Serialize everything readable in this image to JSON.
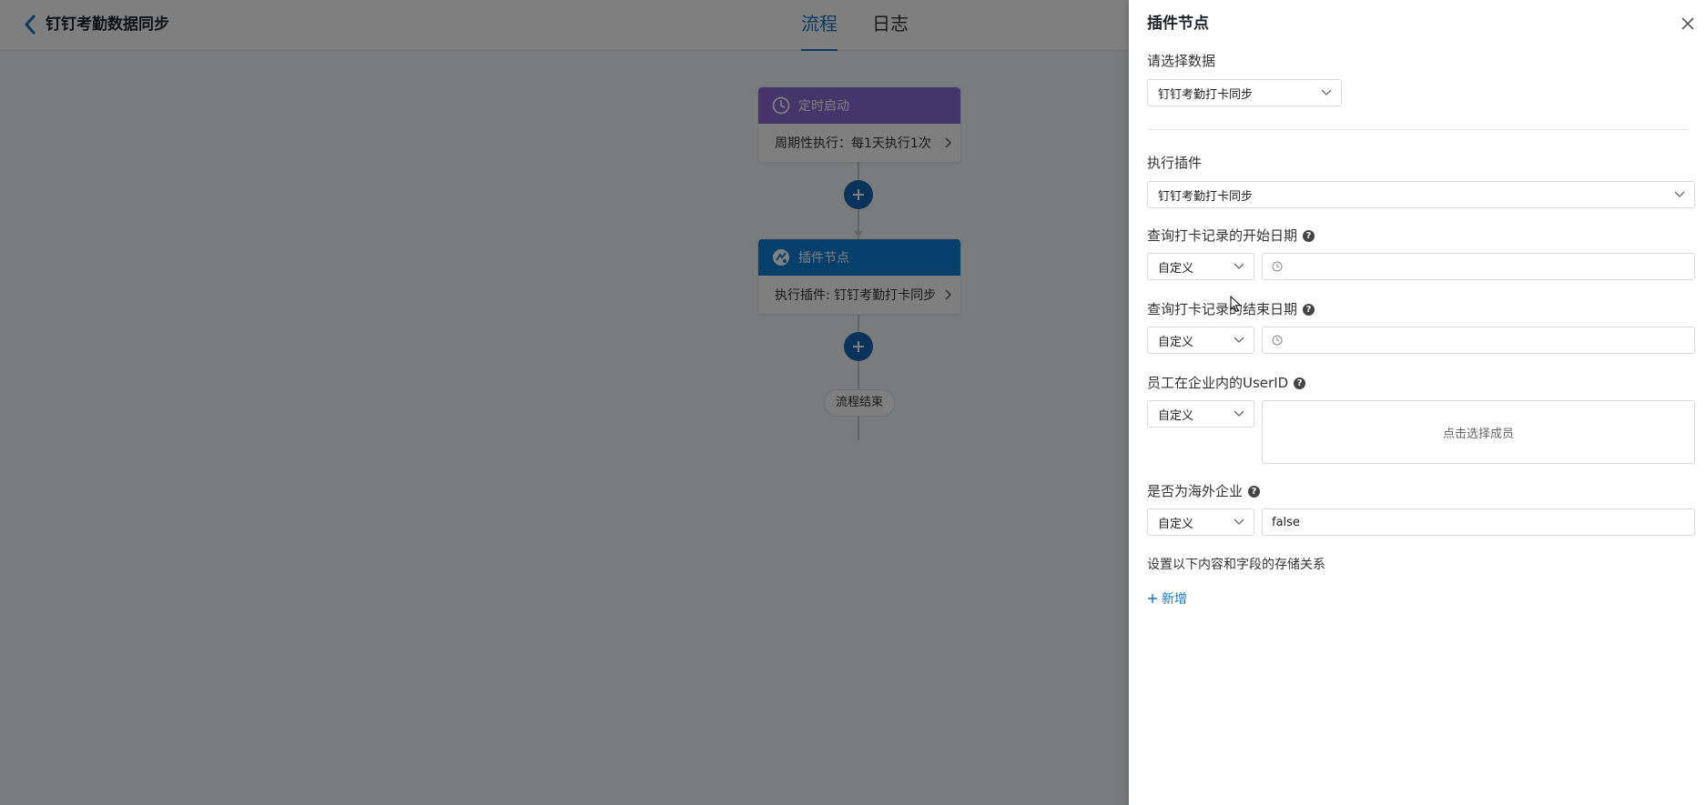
{
  "header": {
    "title": "钉钉考勤数据同步",
    "tabs": [
      {
        "label": "流程",
        "active": true
      },
      {
        "label": "日志",
        "active": false
      }
    ]
  },
  "flow": {
    "nodes": [
      {
        "title": "定时启动",
        "detail": "周期性执行：每1天执行1次",
        "color": "#8d6bd6",
        "icon": "clock-icon"
      },
      {
        "title": "插件节点",
        "detail": "执行插件: 钉钉考勤打卡同步",
        "color": "#0a7fd6",
        "icon": "plugin-icon"
      }
    ],
    "end_label": "流程结束"
  },
  "panel": {
    "title": "插件节点",
    "select_data": {
      "label": "请选择数据",
      "value": "钉钉考勤打卡同步"
    },
    "plugin": {
      "label": "执行插件",
      "value": "钉钉考勤打卡同步"
    },
    "start_date": {
      "label": "查询打卡记录的开始日期",
      "mode": "自定义",
      "value": ""
    },
    "end_date": {
      "label": "查询打卡记录的结束日期",
      "mode": "自定义",
      "value": ""
    },
    "userid": {
      "label": "员工在企业内的UserID",
      "mode": "自定义",
      "placeholder": "点击选择成员"
    },
    "overseas": {
      "label": "是否为海外企业",
      "mode": "自定义",
      "value": "false"
    },
    "mapping_label": "设置以下内容和字段的存储关系",
    "add_label": "新增"
  },
  "colors": {
    "accent": "#1677c9",
    "overlay": "rgba(0,0,0,0.5)"
  }
}
